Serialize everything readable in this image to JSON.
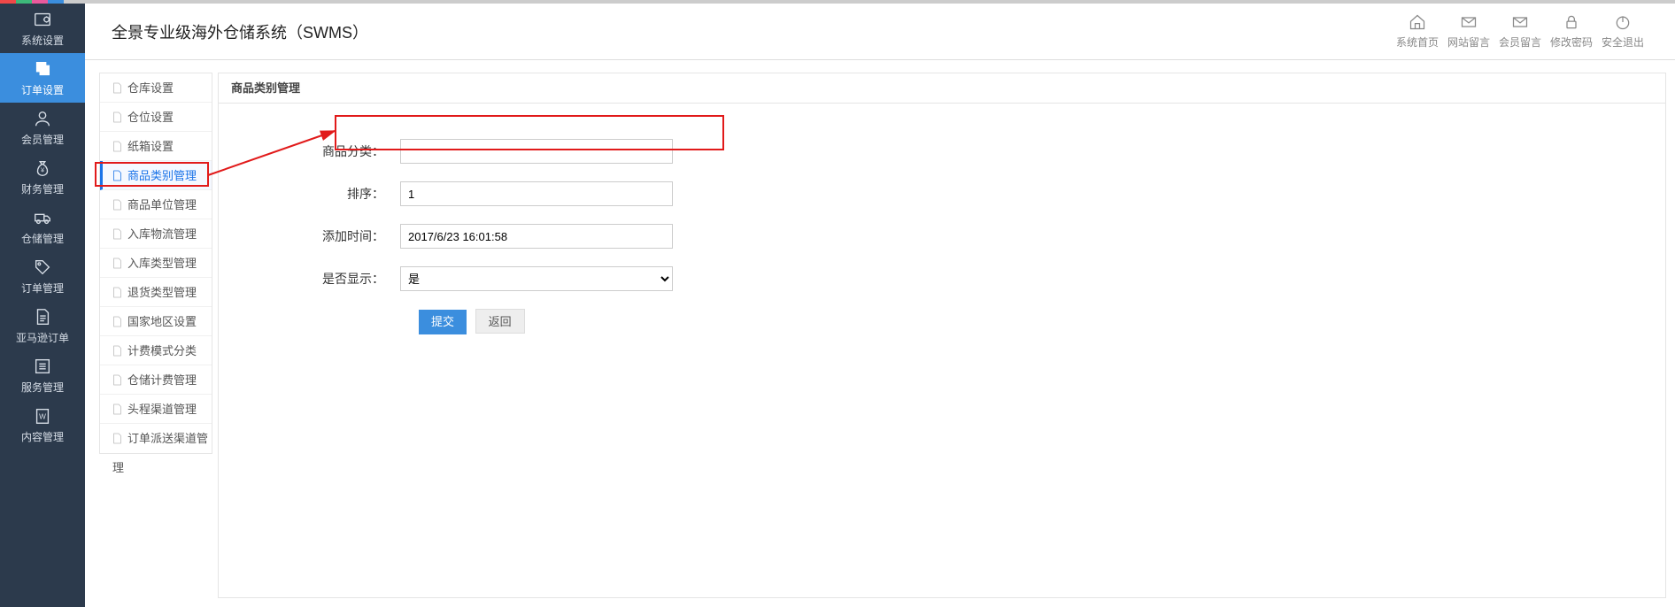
{
  "header": {
    "title": "全景专业级海外仓储系统（SWMS）",
    "tools": [
      {
        "name": "home",
        "label": "系统首页"
      },
      {
        "name": "sitemsg",
        "label": "网站留言"
      },
      {
        "name": "membermsg",
        "label": "会员留言"
      },
      {
        "name": "password",
        "label": "修改密码"
      },
      {
        "name": "logout",
        "label": "安全退出"
      }
    ]
  },
  "leftnav": [
    {
      "name": "sys",
      "label": "系统设置"
    },
    {
      "name": "order",
      "label": "订单设置",
      "active": true
    },
    {
      "name": "member",
      "label": "会员管理"
    },
    {
      "name": "finance",
      "label": "财务管理"
    },
    {
      "name": "warehouse",
      "label": "仓储管理"
    },
    {
      "name": "ordermgr",
      "label": "订单管理"
    },
    {
      "name": "amazon",
      "label": "亚马逊订单"
    },
    {
      "name": "service",
      "label": "服务管理"
    },
    {
      "name": "content",
      "label": "内容管理"
    }
  ],
  "subnav": [
    {
      "label": "仓库设置"
    },
    {
      "label": "仓位设置"
    },
    {
      "label": "纸箱设置"
    },
    {
      "label": "商品类别管理",
      "active": true
    },
    {
      "label": "商品单位管理"
    },
    {
      "label": "入库物流管理"
    },
    {
      "label": "入库类型管理"
    },
    {
      "label": "退货类型管理"
    },
    {
      "label": "国家地区设置"
    },
    {
      "label": "计费模式分类"
    },
    {
      "label": "仓储计费管理"
    },
    {
      "label": "头程渠道管理"
    },
    {
      "label": "订单派送渠道管理"
    }
  ],
  "panel": {
    "title": "商品类别管理",
    "fields": {
      "category_label": "商品分类：",
      "category_value": "",
      "sort_label": "排序：",
      "sort_value": "1",
      "addtime_label": "添加时间：",
      "addtime_value": "2017/6/23 16:01:58",
      "display_label": "是否显示：",
      "display_value": "是"
    },
    "buttons": {
      "submit": "提交",
      "back": "返回"
    }
  }
}
